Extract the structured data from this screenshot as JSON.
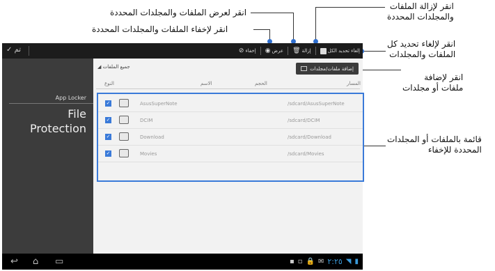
{
  "callouts": {
    "remove": "انقر لإزالة الملفات\nوالمجلدات المحددة",
    "view": "انقر لعرض الملفات والمجلدات المحددة",
    "hide": "انقر لإخفاء الملفات والمجلدات المحددة",
    "deselect": "انقر لإلغاء تحديد كل\nالملفات والمجلدات",
    "add": "انقر لإضافة\nملفات أو مجلدات",
    "list": "قائمة بالملفات أو المجلدات\nالمحددة للإخفاء"
  },
  "topbar": {
    "ok_label": "تم",
    "deselect_all": "إلغاء تحديد الكل",
    "remove": "إزالة",
    "view": "عرض",
    "hide": "إخفاء"
  },
  "sidebar": {
    "app_name": "App Locker",
    "section_title": "File Protection"
  },
  "main": {
    "all_files": "جميع الملفات",
    "add_button": "إضافة ملفات/مجلدات",
    "columns": {
      "type": "النوع",
      "name": "الاسم",
      "size": "الحجم",
      "path": "المسار"
    },
    "rows": [
      {
        "name": "AsusSuperNote",
        "path": "/sdcard/AsusSuperNote"
      },
      {
        "name": "DCIM",
        "path": "/sdcard/DCIM"
      },
      {
        "name": "Download",
        "path": "/sdcard/Download"
      },
      {
        "name": "Movies",
        "path": "/sdcard/Movies"
      }
    ]
  },
  "statusbar": {
    "time": "٢:٢٥"
  },
  "colors": {
    "accent": "#3a7ad9",
    "sidebar": "#3c3c3c",
    "topbar": "#1c1c1c"
  }
}
